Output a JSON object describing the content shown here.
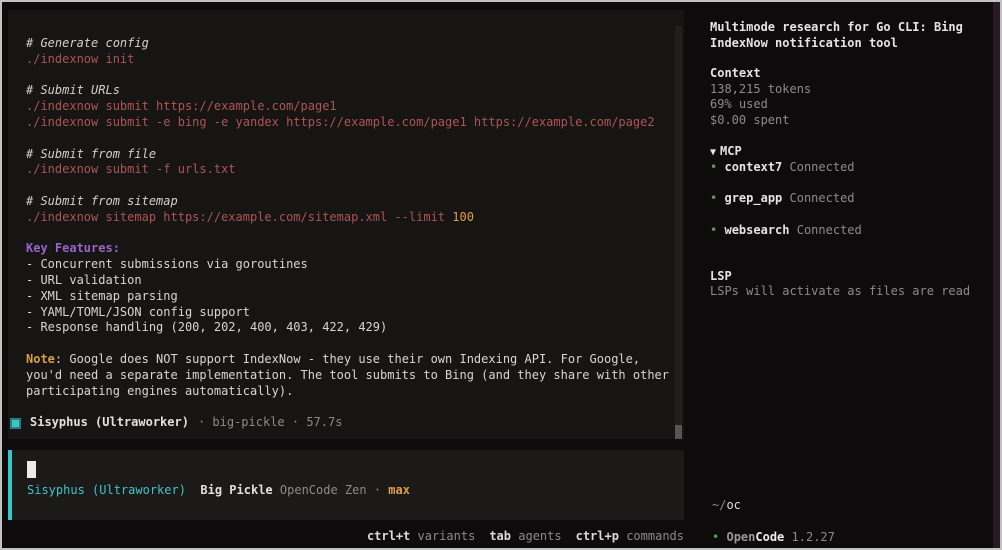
{
  "colors": {
    "teal_accent": "#3bc6c6",
    "command_red": "#ad5456",
    "heading_purple": "#9a63c8",
    "note_orange": "#dca044",
    "connected_green": "#55a055",
    "muted_gray": "#8f8a8a",
    "panel_bg": "#171414",
    "editor_bg": "#1c1919"
  },
  "terminal": {
    "lines": [
      {
        "segments": [
          {
            "t": "# Generate config",
            "s": "comment"
          }
        ]
      },
      {
        "segments": [
          {
            "t": "./indexnow init",
            "s": "cmd"
          }
        ]
      },
      {
        "segments": []
      },
      {
        "segments": [
          {
            "t": "# Submit URLs",
            "s": "comment"
          }
        ]
      },
      {
        "segments": [
          {
            "t": "./indexnow submit https://example.com/page1",
            "s": "cmd"
          }
        ]
      },
      {
        "segments": [
          {
            "t": "./indexnow submit -e bing -e yandex https://example.com/page1 https://example.com/page2",
            "s": "cmd"
          }
        ]
      },
      {
        "segments": []
      },
      {
        "segments": [
          {
            "t": "# Submit from file",
            "s": "comment"
          }
        ]
      },
      {
        "segments": [
          {
            "t": "./indexnow submit -f urls.txt",
            "s": "cmd"
          }
        ]
      },
      {
        "segments": []
      },
      {
        "segments": [
          {
            "t": "# Submit from sitemap",
            "s": "comment"
          }
        ]
      },
      {
        "segments": [
          {
            "t": "./indexnow sitemap https://example.com/sitemap.xml --limit ",
            "s": "cmd"
          },
          {
            "t": "100",
            "s": "num"
          }
        ]
      },
      {
        "segments": []
      },
      {
        "segments": [
          {
            "t": "Key Features:",
            "s": "heading"
          }
        ]
      },
      {
        "segments": [
          {
            "t": "- Concurrent submissions via goroutines",
            "s": "body"
          }
        ]
      },
      {
        "segments": [
          {
            "t": "- URL validation",
            "s": "body"
          }
        ]
      },
      {
        "segments": [
          {
            "t": "- XML sitemap parsing",
            "s": "body"
          }
        ]
      },
      {
        "segments": [
          {
            "t": "- YAML/TOML/JSON config support",
            "s": "body"
          }
        ]
      },
      {
        "segments": [
          {
            "t": "- Response handling (200, 202, 400, 403, 422, 429)",
            "s": "body"
          }
        ]
      },
      {
        "segments": []
      },
      {
        "segments": [
          {
            "t": "Note",
            "s": "note"
          },
          {
            "t": ": Google does NOT support IndexNow - they use their own Indexing API. For Google,",
            "s": "body"
          }
        ]
      },
      {
        "segments": [
          {
            "t": "you'd need a separate implementation. The tool submits to Bing (and they share with other",
            "s": "body"
          }
        ]
      },
      {
        "segments": [
          {
            "t": "participating engines automatically).",
            "s": "body"
          }
        ]
      }
    ],
    "status": {
      "agent": "Sisyphus (Ultraworker)",
      "meta": "· big-pickle · 57.7s"
    }
  },
  "editor": {
    "agent": "Sisyphus (Ultraworker)",
    "model": "Big Pickle",
    "provider": "OpenCode Zen",
    "separator": "·",
    "mode": "max"
  },
  "statusbar": {
    "hints": [
      {
        "key": "ctrl+t",
        "label": "variants"
      },
      {
        "key": "tab",
        "label": "agents"
      },
      {
        "key": "ctrl+p",
        "label": "commands"
      }
    ]
  },
  "sidebar": {
    "title": "Multimode research for Go CLI: Bing IndexNow notification tool",
    "context": {
      "heading": "Context",
      "tokens": "138,215 tokens",
      "used": "69% used",
      "spent": "$0.00 spent"
    },
    "mcp": {
      "collapse_icon": "▼",
      "heading": "MCP",
      "bullet": "•",
      "servers": [
        {
          "name": "context7",
          "status": "Connected"
        },
        {
          "name": "grep_app",
          "status": "Connected"
        },
        {
          "name": "websearch",
          "status": "Connected"
        }
      ]
    },
    "lsp": {
      "heading": "LSP",
      "message": "LSPs will activate as files are read"
    },
    "footer": {
      "path_prefix": "~/",
      "path_name": "oc",
      "bullet": "•",
      "brand_prefix": "Open",
      "brand_suffix": "Code",
      "version": "1.2.27"
    }
  }
}
